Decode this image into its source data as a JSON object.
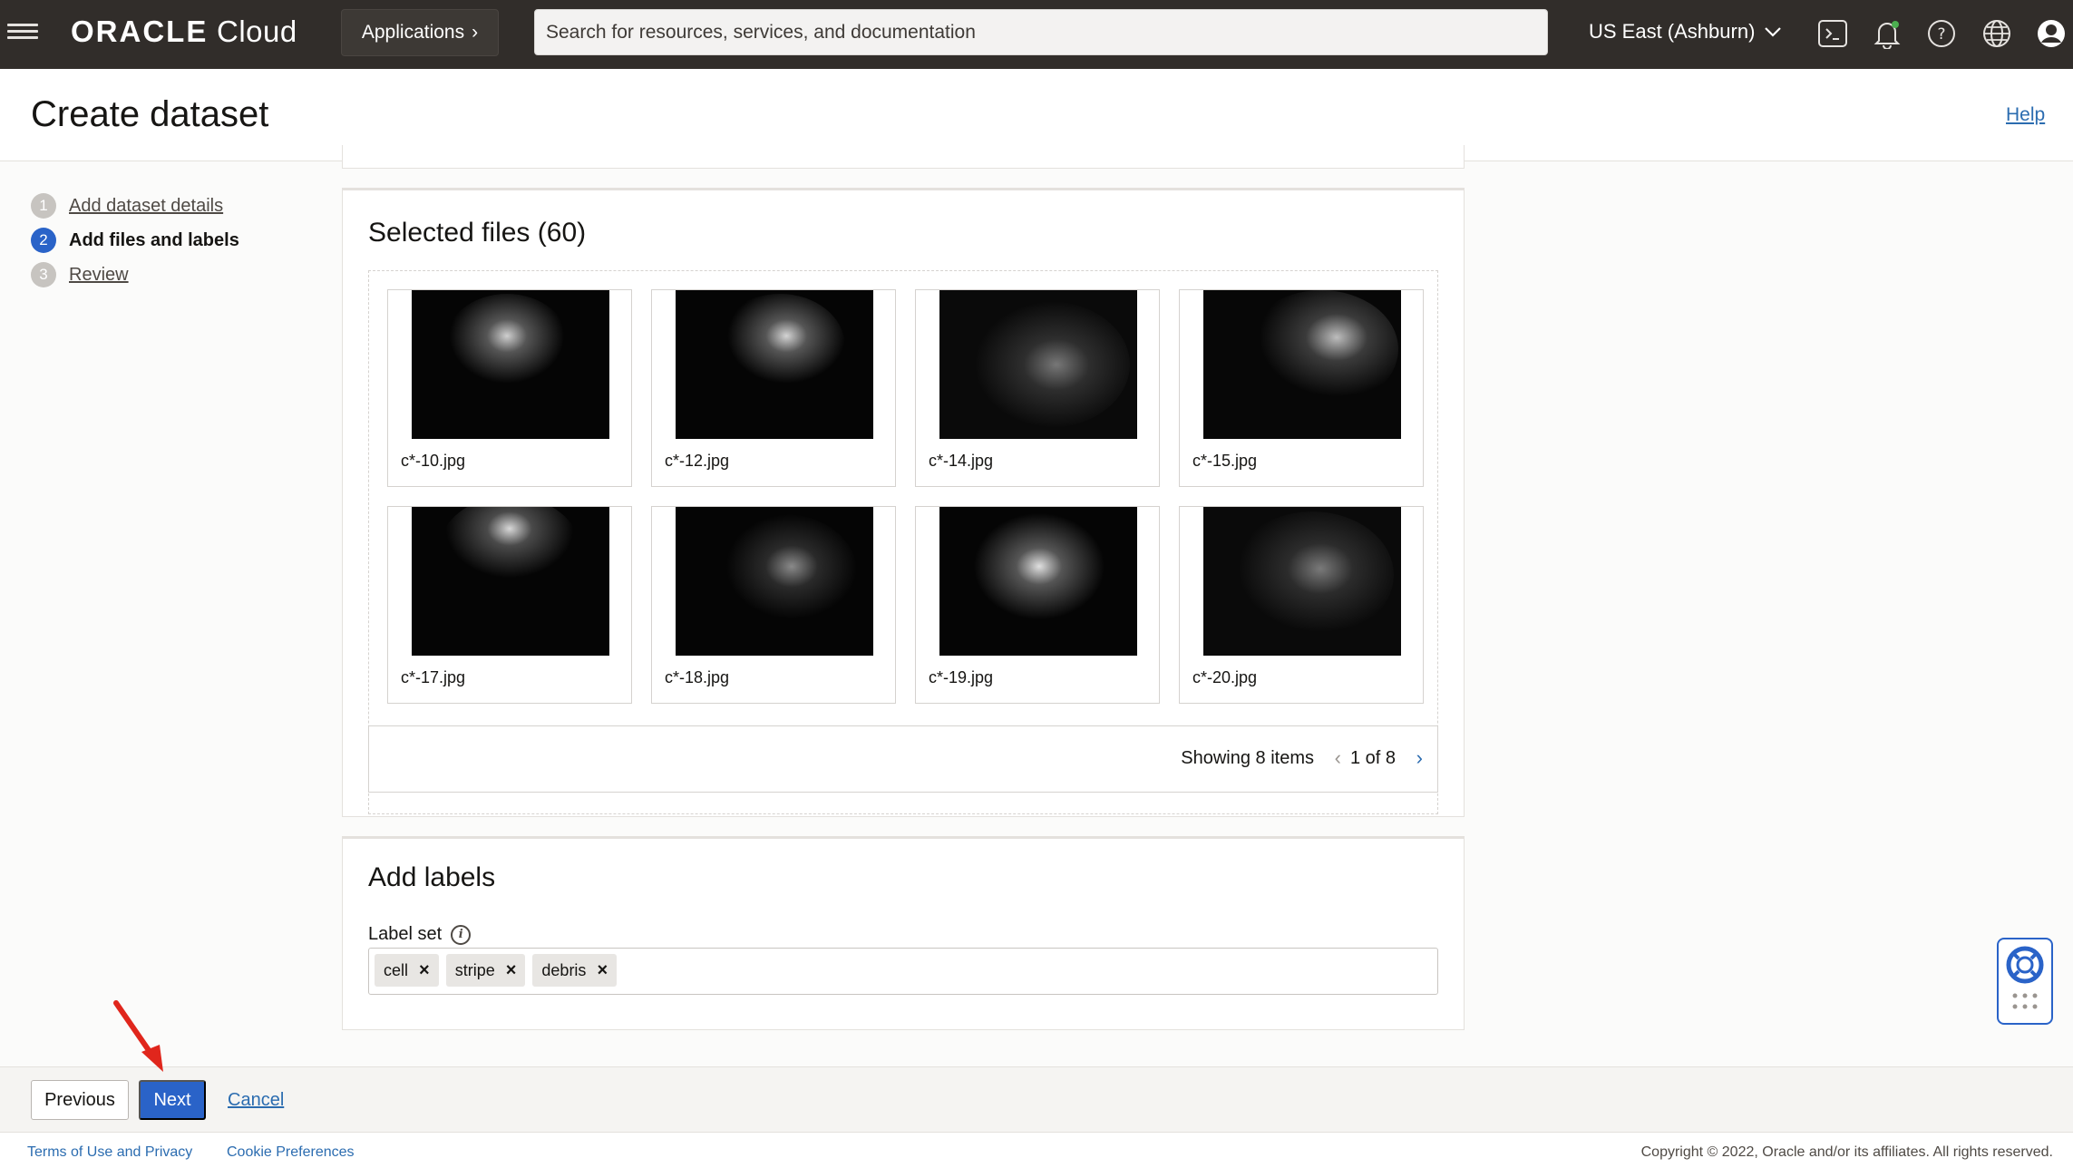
{
  "topbar": {
    "brand_bold": "ORACLE",
    "brand_light": "Cloud",
    "applications_label": "Applications",
    "search_placeholder": "Search for resources, services, and documentation",
    "region": "US East (Ashburn)",
    "icons": [
      "hamburger-menu-icon",
      "cloud-shell-icon",
      "bell-icon",
      "help-icon",
      "globe-icon",
      "user-icon"
    ]
  },
  "header": {
    "title": "Create dataset",
    "help_link": "Help"
  },
  "steps": [
    {
      "number": "1",
      "label": "Add dataset details",
      "state": "done"
    },
    {
      "number": "2",
      "label": "Add files and labels",
      "state": "active"
    },
    {
      "number": "3",
      "label": "Review",
      "state": "pending"
    }
  ],
  "selected_files": {
    "title": "Selected files (60)",
    "files": [
      "c*-10.jpg",
      "c*-12.jpg",
      "c*-14.jpg",
      "c*-15.jpg",
      "c*-17.jpg",
      "c*-18.jpg",
      "c*-19.jpg",
      "c*-20.jpg"
    ],
    "pager": {
      "showing": "Showing 8 items",
      "page": "1 of 8"
    }
  },
  "add_labels": {
    "title": "Add labels",
    "label_set_caption": "Label set",
    "chips": [
      "cell",
      "stripe",
      "debris"
    ],
    "chip_remove": "×"
  },
  "actions": {
    "previous": "Previous",
    "next": "Next",
    "cancel": "Cancel"
  },
  "footer": {
    "terms": "Terms of Use and Privacy",
    "cookies": "Cookie Preferences",
    "copyright": "Copyright © 2022, Oracle and/or its affiliates. All rights reserved."
  },
  "colors": {
    "topbar": "#312d2a",
    "primary": "#2a63c8",
    "link": "#2b6cb0",
    "annotation_arrow": "#e0261c"
  }
}
